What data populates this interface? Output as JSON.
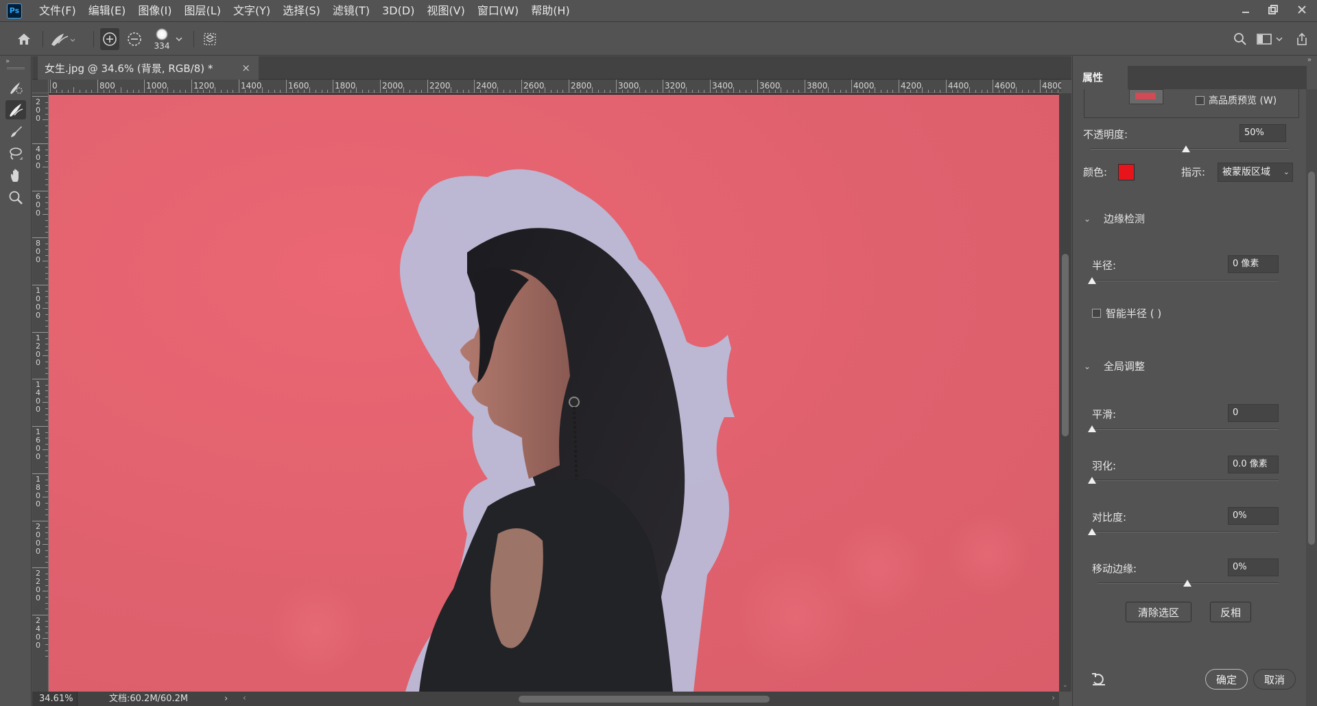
{
  "app": {
    "logo": "Ps",
    "menu": [
      "文件(F)",
      "编辑(E)",
      "图像(I)",
      "图层(L)",
      "文字(Y)",
      "选择(S)",
      "滤镜(T)",
      "3D(D)",
      "视图(V)",
      "窗口(W)",
      "帮助(H)"
    ]
  },
  "options_bar": {
    "brush_size": "334"
  },
  "document": {
    "tab_title": "女生.jpg @ 34.6% (背景, RGB/8) *",
    "tab_close": "×"
  },
  "rulers": {
    "horizontal": [
      "0",
      "800",
      "1000",
      "1200",
      "1400",
      "1600",
      "1800",
      "2000",
      "2200",
      "2400",
      "2600",
      "2800",
      "3000",
      "3200",
      "3400",
      "3600",
      "3800",
      "4000",
      "4200",
      "4400",
      "4600",
      "4800"
    ],
    "vertical": [
      "200",
      "400",
      "600",
      "800",
      "1000",
      "1200",
      "1400",
      "1600",
      "1800",
      "2000",
      "2200",
      "2400"
    ]
  },
  "status": {
    "zoom": "34.61%",
    "doc_size": "文档:60.2M/60.2M"
  },
  "properties_panel": {
    "tab_label": "属性",
    "high_quality_preview": "高品质预览 (W)",
    "opacity_label": "不透明度:",
    "opacity_value": "50%",
    "color_label": "颜色:",
    "overlay_color": "#e8141c",
    "indicate_label": "指示:",
    "indicate_value": "被蒙版区域",
    "edge_detection": {
      "title": "边缘检测",
      "radius_label": "半径:",
      "radius_value": "0 像素",
      "smart_radius_label": "智能半径 (  )"
    },
    "global_refinements": {
      "title": "全局调整",
      "smooth_label": "平滑:",
      "smooth_value": "0",
      "feather_label": "羽化:",
      "feather_value": "0.0 像素",
      "contrast_label": "对比度:",
      "contrast_value": "0%",
      "shift_edge_label": "移动边缘:",
      "shift_edge_value": "0%"
    },
    "clear_selection_button": "清除选区",
    "invert_button": "反相",
    "ok_button": "确定",
    "cancel_button": "取消"
  }
}
